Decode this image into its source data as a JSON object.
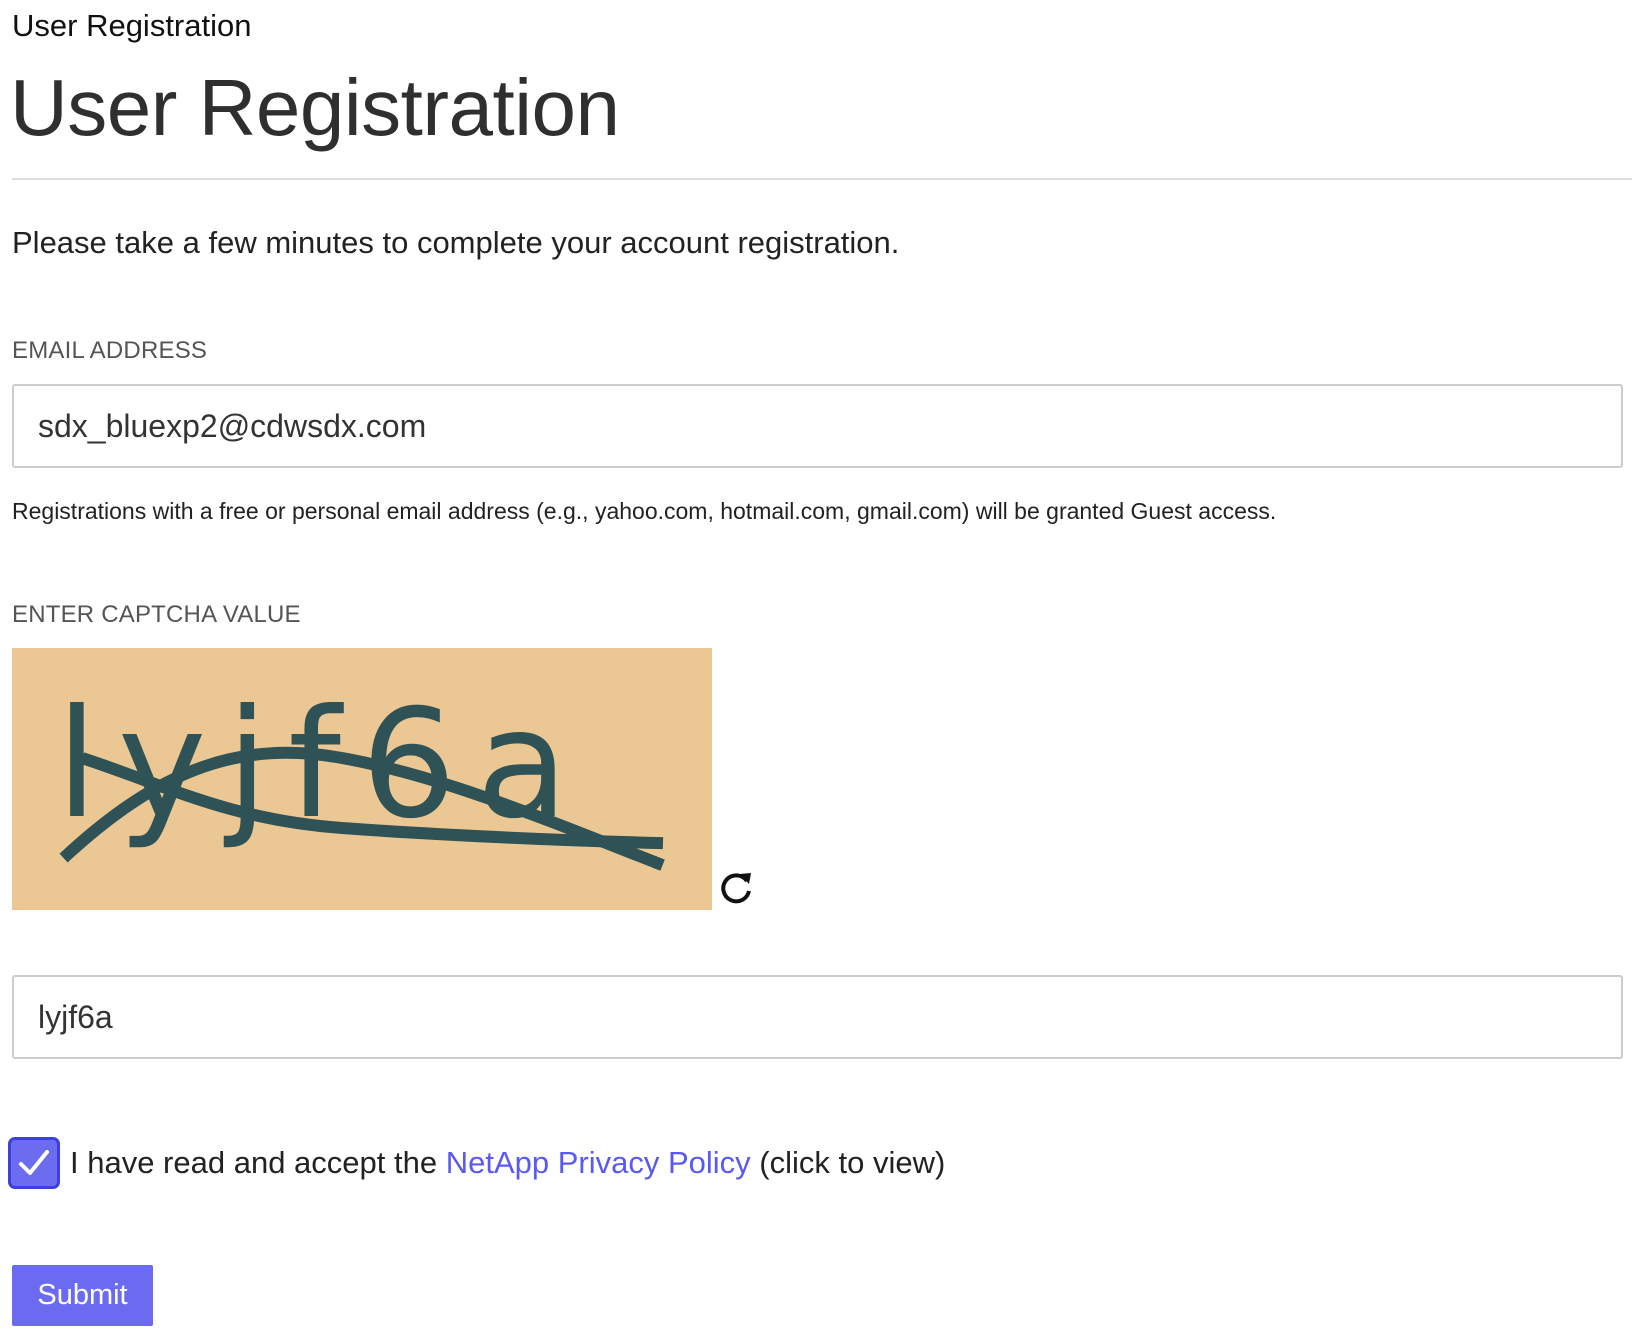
{
  "browser": {
    "tab_title": "User Registration"
  },
  "header": {
    "title": "User Registration"
  },
  "form": {
    "intro": "Please take a few minutes to complete your account registration.",
    "email": {
      "label": "EMAIL ADDRESS",
      "value": "sdx_bluexp2@cdwsdx.com",
      "help": "Registrations with a free or personal email address (e.g., yahoo.com, hotmail.com, gmail.com) will be granted Guest access."
    },
    "captcha": {
      "label": "ENTER CAPTCHA VALUE",
      "image_text": "lyjf6a",
      "refresh_icon": "refresh-icon",
      "value": "lyjf6a",
      "colors": {
        "background": "#ebc794",
        "foreground": "#2f5256"
      }
    },
    "privacy": {
      "checked": true,
      "prefix": "I have read and accept the ",
      "link_text": "NetApp Privacy Policy",
      "suffix": " (click to view)"
    },
    "submit_label": "Submit"
  },
  "colors": {
    "accent": "#6b6bf2",
    "link": "#5a5af0"
  }
}
